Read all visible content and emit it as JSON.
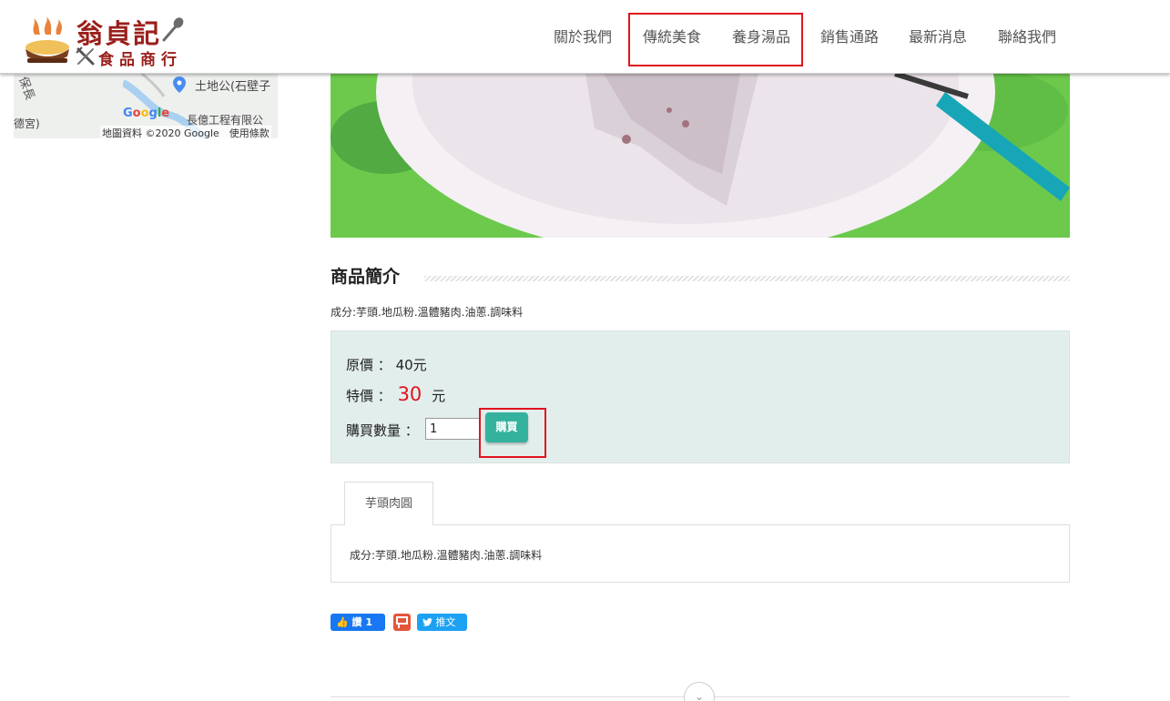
{
  "header": {
    "logo_title": "翁貞記",
    "logo_subtitle": "食品商行",
    "nav": [
      "關於我們",
      "傳統美食",
      "養身湯品",
      "銷售通路",
      "最新消息",
      "聯絡我們"
    ]
  },
  "map": {
    "place_shrine": "土地公(石壁子",
    "place_company": "長億工程有限公",
    "place_temple": "德宮)",
    "road": "保長",
    "google_logo": "Google",
    "credits": "地圖資料 ©2020 Google　使用條款"
  },
  "product": {
    "section_title": "商品簡介",
    "ingredients": "成分:芋頭.地瓜粉.溫體豬肉.油蔥.調味料",
    "price_box": {
      "original_label": "原價 ：",
      "original_price": "40元",
      "sale_label": "特價 ：",
      "sale_price": "30",
      "sale_unit": "元",
      "qty_label": "購買數量 ：",
      "qty_value": "1",
      "buy_label": "購買"
    },
    "tabs": [
      {
        "label": "芋頭肉圓"
      }
    ],
    "tab_content": "成分:芋頭.地瓜粉.溫體豬肉.油蔥.調味料"
  },
  "social": {
    "fb_label": "讚 1",
    "tw_label": "推文"
  },
  "colors": {
    "brand_red": "#9a1f1b",
    "highlight": "#e0141e",
    "price_box_bg": "#e2eeec",
    "buy_button": "#34b29e",
    "photo_bg": "#69c94a"
  }
}
